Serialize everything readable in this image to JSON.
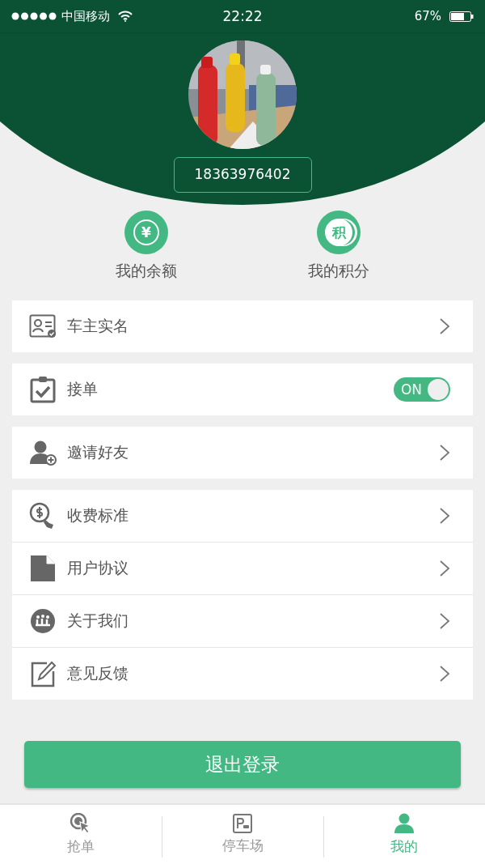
{
  "status_bar": {
    "carrier": "中国移动",
    "time": "22:22",
    "battery": "67%"
  },
  "profile": {
    "phone": "18363976402"
  },
  "quick_actions": [
    {
      "glyph": "¥",
      "label": "我的余额"
    },
    {
      "glyph": "积",
      "label": "我的积分"
    }
  ],
  "menu_groups": [
    [
      {
        "kind": "link",
        "label": "车主实名"
      }
    ],
    [
      {
        "kind": "toggle",
        "label": "接单",
        "on": true,
        "toggle_text": "ON"
      }
    ],
    [
      {
        "kind": "link",
        "label": "邀请好友"
      }
    ],
    [
      {
        "kind": "link",
        "label": "收费标准"
      },
      {
        "kind": "link",
        "label": "用户协议"
      },
      {
        "kind": "link",
        "label": "关于我们"
      },
      {
        "kind": "link",
        "label": "意见反馈"
      }
    ]
  ],
  "logout_button": "退出登录",
  "tab_bar": [
    {
      "label": "抢单",
      "selected": false
    },
    {
      "label": "停车场",
      "selected": false
    },
    {
      "label": "我的",
      "selected": true
    }
  ]
}
